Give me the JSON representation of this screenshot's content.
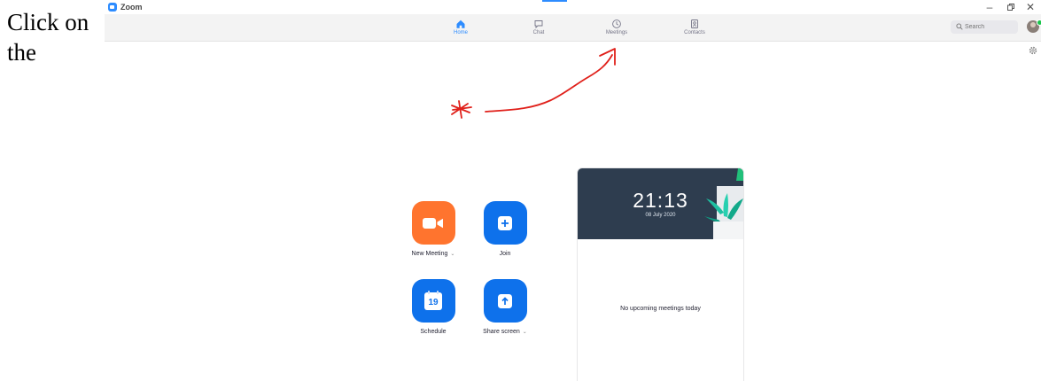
{
  "caption": {
    "line1": "Click on",
    "line2": "the"
  },
  "window": {
    "title": "Zoom",
    "minimize": "–",
    "close": "✕"
  },
  "nav": {
    "tabs": [
      {
        "label": "Home",
        "icon": "home-icon",
        "active": true
      },
      {
        "label": "Chat",
        "icon": "chat-icon",
        "active": false
      },
      {
        "label": "Meetings",
        "icon": "clock-icon",
        "active": false
      },
      {
        "label": "Contacts",
        "icon": "contacts-icon",
        "active": false
      }
    ]
  },
  "search": {
    "placeholder": "Search"
  },
  "actions": {
    "new_meeting": {
      "label": "New Meeting",
      "caret": "⌄",
      "color": "#ff742e",
      "icon": "video-camera-icon"
    },
    "join": {
      "label": "Join",
      "color": "#0e71eb",
      "icon": "plus-icon"
    },
    "schedule": {
      "label": "Schedule",
      "day": "19",
      "color": "#0e71eb",
      "icon": "calendar-icon"
    },
    "share_screen": {
      "label": "Share screen",
      "caret": "⌄",
      "color": "#0e71eb",
      "icon": "share-up-arrow-icon"
    }
  },
  "card": {
    "time": "21:13",
    "date": "08 July 2020",
    "empty_message": "No upcoming meetings today",
    "header_color": "#2e3d4f"
  },
  "colors": {
    "accent": "#2d8cff",
    "annotation": "#e0201a"
  }
}
